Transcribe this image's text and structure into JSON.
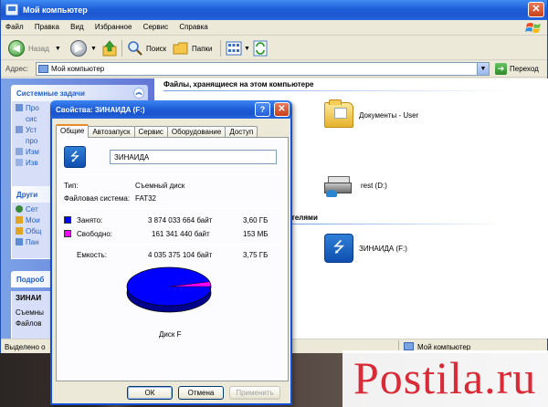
{
  "explorer": {
    "title": "Мой компьютер",
    "menu": [
      "Файл",
      "Правка",
      "Вид",
      "Избранное",
      "Сервис",
      "Справка"
    ],
    "toolbar": {
      "back_label": "Назад",
      "search_label": "Поиск",
      "folders_label": "Папки"
    },
    "address": {
      "label": "Адрес:",
      "value": "Мой компьютер",
      "go_label": "Переход"
    },
    "left_panels": {
      "system_tasks": {
        "title": "Системные задачи",
        "rows": [
          "Про",
          "сис",
          "Уст",
          "про",
          "Изм",
          "Изв"
        ]
      },
      "other_places": {
        "title": "Други",
        "rows": [
          "Сет",
          "Мои",
          "Общ",
          "Пан"
        ]
      },
      "details": {
        "title": "Подроб",
        "rows": [
          "ЗИНАИ",
          "Съемны",
          "Файлов"
        ]
      }
    },
    "content": {
      "group_files": "Файлы, хранящиеся на этом компьютере",
      "item_documents": "Документы - User",
      "item_rest": "rest (D:)",
      "group_removable": "ителями",
      "item_usb": "ЗИНАИДА (F:)"
    },
    "status": {
      "left": "Выделено о",
      "right": "Мой компьютер"
    }
  },
  "dialog": {
    "title": "Свойства: ЗИНАИДА (F:)",
    "help": "?",
    "close": "✕",
    "tabs": [
      "Общие",
      "Автозапуск",
      "Сервис",
      "Оборудование",
      "Доступ"
    ],
    "name_value": "ЗИНАИДА",
    "type_label": "Тип:",
    "type_value": "Съемный диск",
    "fs_label": "Файловая система:",
    "fs_value": "FAT32",
    "used_label": "Занято:",
    "used_bytes": "3 874 033 664 байт",
    "used_size": "3,60 ГБ",
    "free_label": "Свободно:",
    "free_bytes": "161 341 440 байт",
    "free_size": "153 МБ",
    "cap_label": "Емкость:",
    "cap_bytes": "4 035 375 104 байт",
    "cap_size": "3,75 ГБ",
    "disk_label": "Диск F",
    "used_fraction": 0.96,
    "colors": {
      "used": "#0000ff",
      "free": "#ff00ff"
    },
    "buttons": {
      "ok": "ОК",
      "cancel": "Отмена",
      "apply": "Применить"
    }
  },
  "watermark": "Postila.ru"
}
